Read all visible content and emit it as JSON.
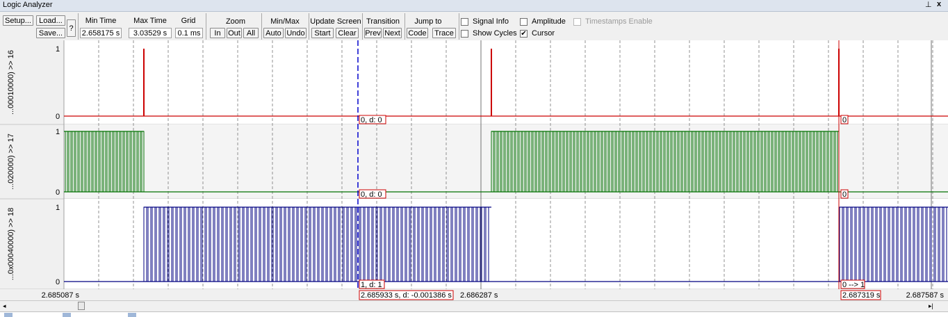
{
  "window": {
    "title": "Logic Analyzer"
  },
  "toolbar": {
    "setup": "Setup...",
    "load": "Load...",
    "save": "Save...",
    "help": "?",
    "min_time": {
      "label": "Min Time",
      "value": "2.658175 s"
    },
    "max_time": {
      "label": "Max Time",
      "value": "3.03529 s"
    },
    "grid": {
      "label": "Grid",
      "value": "0.1 ms"
    },
    "zoom": {
      "label": "Zoom",
      "in": "In",
      "out": "Out",
      "all": "All"
    },
    "minmax": {
      "label": "Min/Max",
      "auto": "Auto",
      "undo": "Undo"
    },
    "update": {
      "label": "Update Screen",
      "start": "Start",
      "clear": "Clear"
    },
    "transition": {
      "label": "Transition",
      "prev": "Prev",
      "next": "Next"
    },
    "jump": {
      "label": "Jump to",
      "code": "Code",
      "trace": "Trace"
    },
    "checks": {
      "signal_info": {
        "label": "Signal Info",
        "checked": false
      },
      "show_cycles": {
        "label": "Show Cycles",
        "checked": false
      },
      "amplitude": {
        "label": "Amplitude",
        "checked": false
      },
      "cursor": {
        "label": "Cursor",
        "checked": true
      },
      "timestamps": {
        "label": "Timestamps Enable",
        "checked": false,
        "disabled": true
      }
    }
  },
  "signals": [
    {
      "name": "...00010000) >> 16",
      "color": "#cc0000",
      "high": "1",
      "low": "0",
      "cursor_label": "0,  d: 0",
      "marker_label": "0",
      "bg": "#ffffff"
    },
    {
      "name": "...020000) >> 17",
      "color": "#007000",
      "high": "1",
      "low": "0",
      "cursor_label": "0,  d: 0",
      "marker_label": "0",
      "bg": "#f4f4f4"
    },
    {
      "name": "...0x00040000) >> 18",
      "color": "#000080",
      "high": "1",
      "low": "0",
      "cursor_label": "1,  d: 1",
      "marker_label": "0 --> 1",
      "bg": "#ffffff"
    }
  ],
  "timeaxis": {
    "left": "2.685087 s",
    "center": "2.686287 s",
    "right": "2.687587 s",
    "cursor_readout": "2.685933 s,  d: -0.001386 s",
    "marker_readout": "2.687319 s"
  },
  "scrollbar": {
    "left_arrow": "◂",
    "right_arrow": "▸|"
  }
}
